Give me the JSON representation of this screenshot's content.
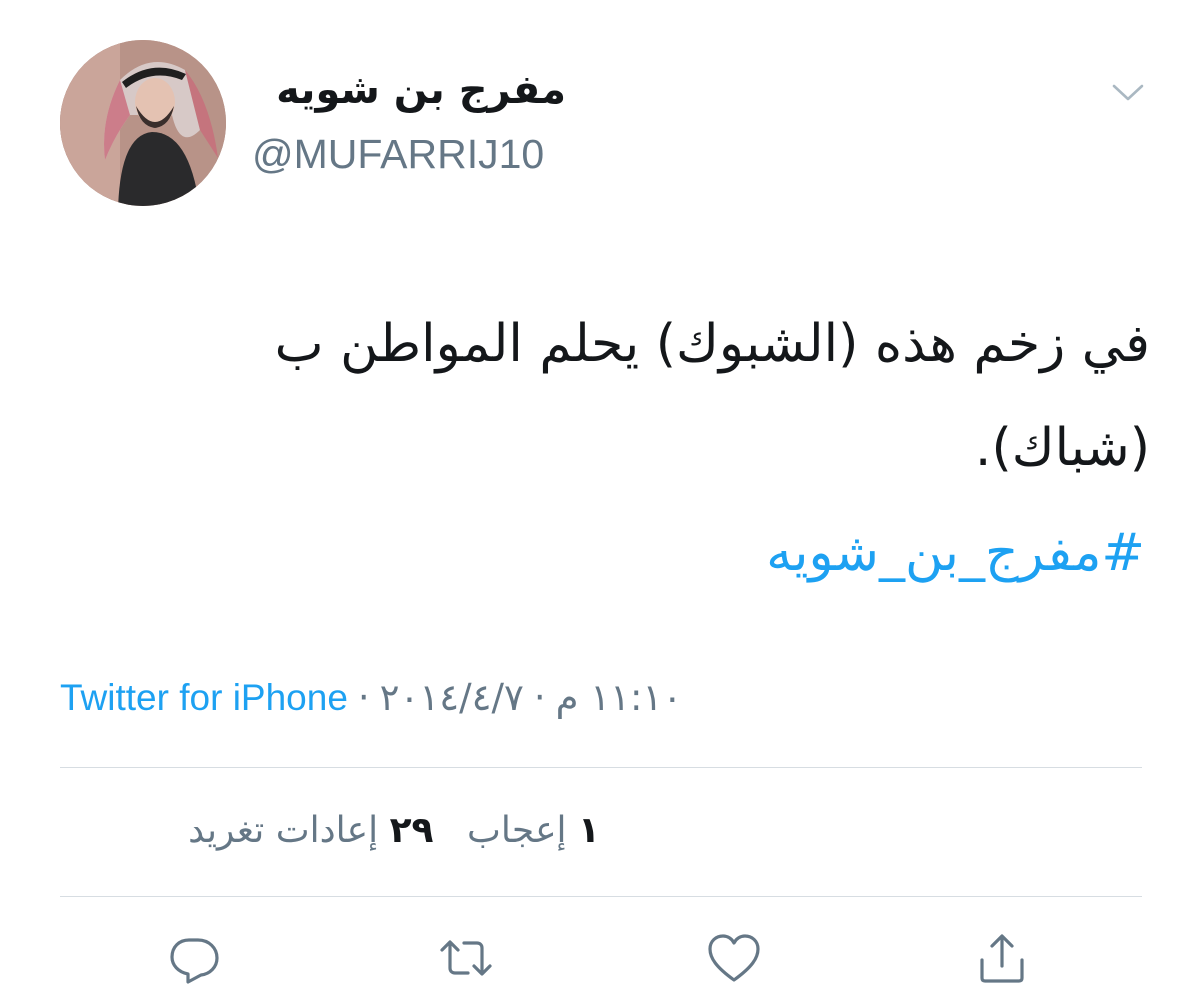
{
  "user": {
    "display_name": "مفرج بن شويه",
    "handle": "@MUFARRIJ10"
  },
  "tweet": {
    "text_line_1": "في زخم هذه (الشبوك) يحلم المواطن ب",
    "text_line_2": "(شباك).",
    "hashtag": "#مفرج_بن_شويه"
  },
  "meta": {
    "time": "١١:١٠ م",
    "date": "٢٠١٤/٤/٧",
    "separator": "·",
    "source": "Twitter for iPhone"
  },
  "stats": {
    "retweets_count": "٢٩",
    "retweets_label": "إعادات تغريد",
    "likes_count": "١",
    "likes_label": "إعجاب"
  },
  "icons": {
    "menu": "chevron-down-icon",
    "reply": "reply-icon",
    "retweet": "retweet-icon",
    "like": "heart-icon",
    "share": "share-icon"
  },
  "colors": {
    "accent": "#1da1f2",
    "secondary_text": "#657786",
    "icon": "#657786",
    "divider": "#d7dde2"
  }
}
